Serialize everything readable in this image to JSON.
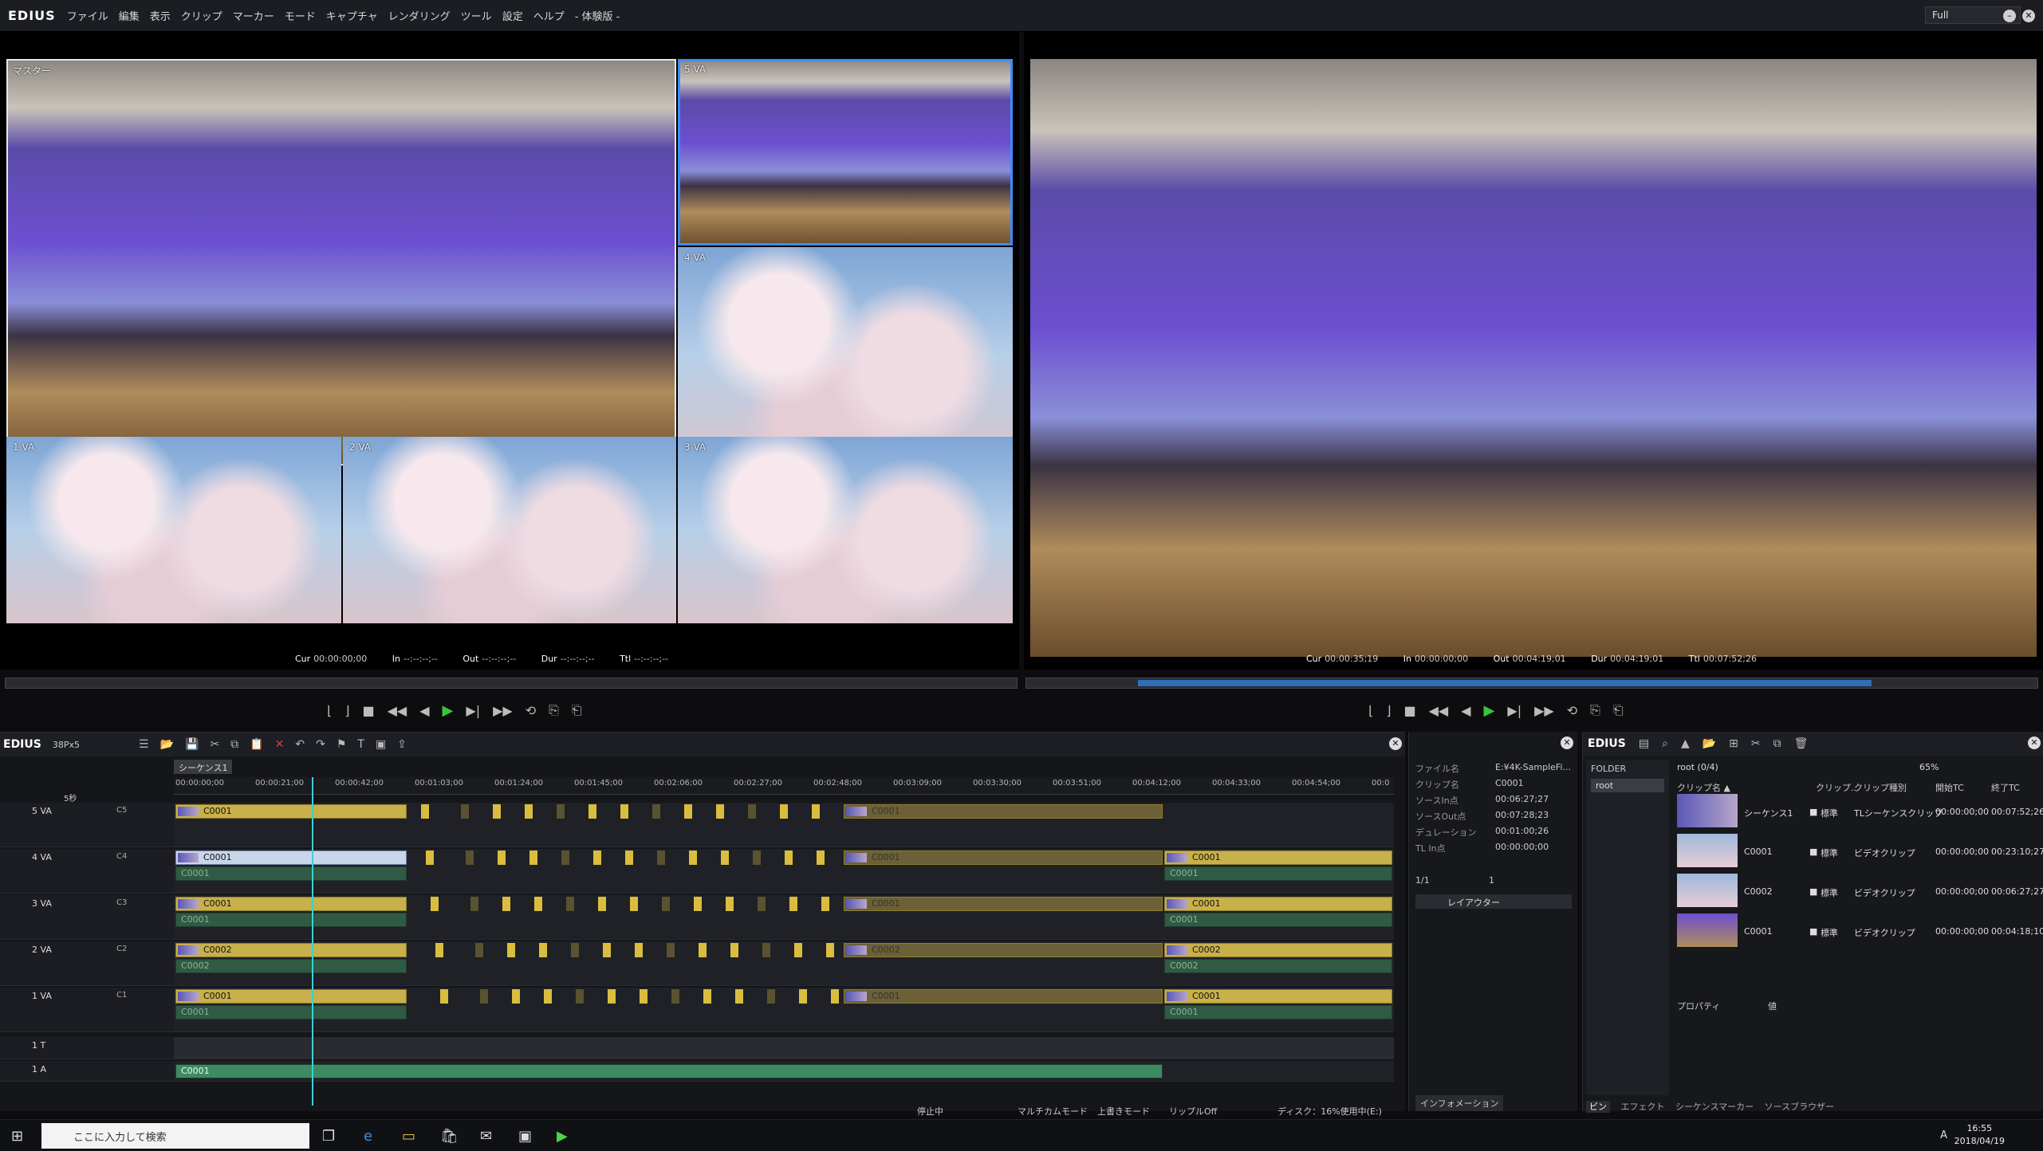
{
  "menubar": {
    "logo": "EDIUS",
    "items": [
      "ファイル",
      "編集",
      "表示",
      "クリップ",
      "マーカー",
      "モード",
      "キャプチャ",
      "レンダリング",
      "ツール",
      "設定",
      "ヘルプ",
      "- 体験版 -"
    ],
    "mode": "Full",
    "mode_caret": "▾",
    "win_min": "–",
    "win_close": "✕"
  },
  "player": {
    "cam_labels": [
      "マスター",
      "5 VA",
      "4 VA",
      "1 VA",
      "2 VA",
      "3 VA"
    ],
    "tc_cur_label": "Cur",
    "tc_cur": "00:00:00;00",
    "tc_in_label": "In",
    "tc_in": "--:--:--;--",
    "tc_out_label": "Out",
    "tc_out": "--:--:--;--",
    "tc_dur_label": "Dur",
    "tc_dur": "--:--:--;--",
    "tc_ttl_label": "Ttl",
    "tc_ttl": "--:--:--;--"
  },
  "recorder": {
    "tc_cur_label": "Cur",
    "tc_cur": "00:00:35;19",
    "tc_in_label": "In",
    "tc_in": "00:00:00;00",
    "tc_out_label": "Out",
    "tc_out": "00:04:19;01",
    "tc_dur_label": "Dur",
    "tc_dur": "00:04:19;01",
    "tc_ttl_label": "Ttl",
    "tc_ttl": "00:07:52;26",
    "position_fraction": 0.11
  },
  "transport": {
    "set_in": "⌊",
    "set_out": "⌋",
    "stop": "■",
    "rewind": "◀◀",
    "step_back": "◀",
    "play": "▶",
    "step_fwd": "▶|",
    "ffwd": "▶▶",
    "loop": "⟲",
    "insert": "⎘",
    "overwrite": "⎗"
  },
  "timeline": {
    "brand": "EDIUS",
    "project": "38Px5",
    "sequence_tab": "シーケンス1",
    "zoom": "5秒",
    "ruler": [
      "00:00:00;00",
      "00:00:21;00",
      "00:00:42;00",
      "00:01:03;00",
      "00:01:24;00",
      "00:01:45;00",
      "00:02:06;00",
      "00:02:27;00",
      "00:02:48;00",
      "00:03:09;00",
      "00:03:30;00",
      "00:03:51;00",
      "00:04:12;00",
      "00:04:33;00",
      "00:04:54;00",
      "00:0"
    ],
    "tracks": [
      {
        "name": "5 VA",
        "ch": "C5",
        "v": "C0001",
        "a": "",
        "v2": "C0001",
        "a2": ""
      },
      {
        "name": "4 VA",
        "ch": "C4",
        "v": "C0001",
        "a": "C0001",
        "v2": "C0001",
        "a2": "C0001"
      },
      {
        "name": "3 VA",
        "ch": "C3",
        "v": "C0001",
        "a": "C0001",
        "v2": "C0001",
        "a2": "C0001"
      },
      {
        "name": "2 VA",
        "ch": "C2",
        "v": "C0002",
        "a": "C0002",
        "v2": "C0002",
        "a2": "C0002"
      },
      {
        "name": "1 VA",
        "ch": "C1",
        "v": "C0001",
        "a": "C0001",
        "v2": "C0001",
        "a2": "C0001"
      }
    ],
    "t_track": "1 T",
    "a_track": "1 A",
    "a_clip": "C0001"
  },
  "info": {
    "rows": [
      {
        "k": "ファイル名",
        "v": "E:¥4K-SampleFi..."
      },
      {
        "k": "クリップ名",
        "v": "C0001"
      },
      {
        "k": "ソースIn点",
        "v": "00:06:27;27"
      },
      {
        "k": "ソースOut点",
        "v": "00:07:28;23"
      },
      {
        "k": "デュレーション",
        "v": "00:01:00;26"
      },
      {
        "k": "TL In点",
        "v": "00:00:00;00"
      }
    ],
    "page": "1/1",
    "count": "1",
    "layer": "レイアウター",
    "tab": "インフォメーション"
  },
  "bin": {
    "brand": "EDIUS",
    "folder_title": "FOLDER",
    "root_label": "root",
    "path": "root (0/4)",
    "zoom": "65%",
    "cols": [
      "クリップ名 ▲",
      "クリップ...",
      "クリップ種別",
      "開始TC",
      "終了TC"
    ],
    "rows": [
      {
        "name": "シーケンス1",
        "mark": "標準",
        "kind": "TLシーケンスクリップ",
        "start": "00:00:00;00",
        "end": "00:07:52;26"
      },
      {
        "name": "C0001",
        "mark": "標準",
        "kind": "ビデオクリップ",
        "start": "00:00:00;00",
        "end": "00:23:10;27"
      },
      {
        "name": "C0002",
        "mark": "標準",
        "kind": "ビデオクリップ",
        "start": "00:00:00;00",
        "end": "00:06:27;27"
      },
      {
        "name": "C0001",
        "mark": "標準",
        "kind": "ビデオクリップ",
        "start": "00:00:00;00",
        "end": "00:04:18;10"
      }
    ],
    "prop_label": "プロパティ",
    "prop_value": "値",
    "tabs": [
      "ビン",
      "エフェクト",
      "シーケンスマーカー",
      "ソースブラウザー"
    ]
  },
  "status": {
    "state": "停止中",
    "multicam": "マルチカムモード",
    "overwrite": "上書きモード",
    "ripple": "リップルOff",
    "disk": "ディスク：16%使用中(E:)"
  },
  "taskbar": {
    "search_placeholder": "ここに入力して検索",
    "time": "16:55",
    "date": "2018/04/19",
    "ime": "A"
  }
}
